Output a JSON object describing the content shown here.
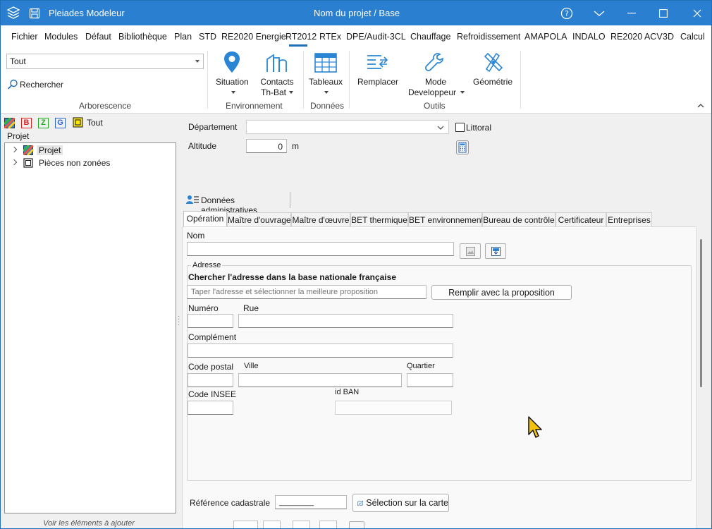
{
  "titlebar": {
    "app_name": "Pleiades Modeleur",
    "document_title": "Nom du projet / Base",
    "accent": "#2a7fd0"
  },
  "menu": [
    "Fichier",
    "Modules",
    "Défaut",
    "Bibliothèque",
    "Plan",
    "STD",
    "RE2020 Energie",
    "RT2012",
    "RTEx",
    "DPE/Audit-3CL",
    "Chauffage",
    "Refroidissement",
    "AMAPOLA",
    "INDALO",
    "RE2020 ACV",
    "3D",
    "Calcul"
  ],
  "menu_active": "RT2012",
  "ribbon": {
    "filter_value": "Tout",
    "search_label": "Rechercher",
    "group_arborescence": "Arborescence",
    "btn_situation": "Situation",
    "btn_contacts_1": "Contacts",
    "btn_contacts_2": "Th-Bat",
    "group_environnement": "Environnement",
    "btn_tableaux": "Tableaux",
    "group_donnees": "Données",
    "btn_remplacer": "Remplacer",
    "btn_mode_1": "Mode",
    "btn_mode_2": "Developpeur",
    "btn_geometrie": "Géométrie",
    "group_outils": "Outils"
  },
  "left": {
    "filter_letters": [
      "B",
      "Z",
      "G"
    ],
    "filter_all": "Tout",
    "tree_header": "Projet",
    "tree_items": [
      "Projet",
      "Pièces non zonées"
    ],
    "footnote": "Voir les éléments à ajouter"
  },
  "form": {
    "departement_label": "Département",
    "departement_value": "",
    "littoral_label": "Littoral",
    "altitude_label": "Altitude",
    "altitude_value": "0",
    "altitude_unit": "m",
    "admin_section": "Données administratives",
    "tabs": [
      "Opération",
      "Maître d'ouvrage",
      "Maître d'œuvre",
      "BET thermique",
      "BET environnement",
      "Bureau de contrôle",
      "Certificateur",
      "Entreprises"
    ],
    "tab_active": "Opération",
    "nom_label": "Nom",
    "nom_value": "",
    "adresse_legend": "Adresse",
    "search_heading": "Chercher l'adresse dans la base nationale française",
    "search_placeholder": "Taper l'adresse et sélectionner la meilleure proposition",
    "fill_button": "Remplir avec la proposition",
    "numero_label": "Numéro",
    "rue_label": "Rue",
    "complement_label": "Complément",
    "code_postal_label": "Code postal",
    "ville_label": "Ville",
    "quartier_label": "Quartier",
    "code_insee_label": "Code INSEE",
    "id_ban_label": "id BAN",
    "cadastre_label": "Référence cadastrale",
    "cadastre_value": "________",
    "map_button": "Sélection sur la carte"
  }
}
